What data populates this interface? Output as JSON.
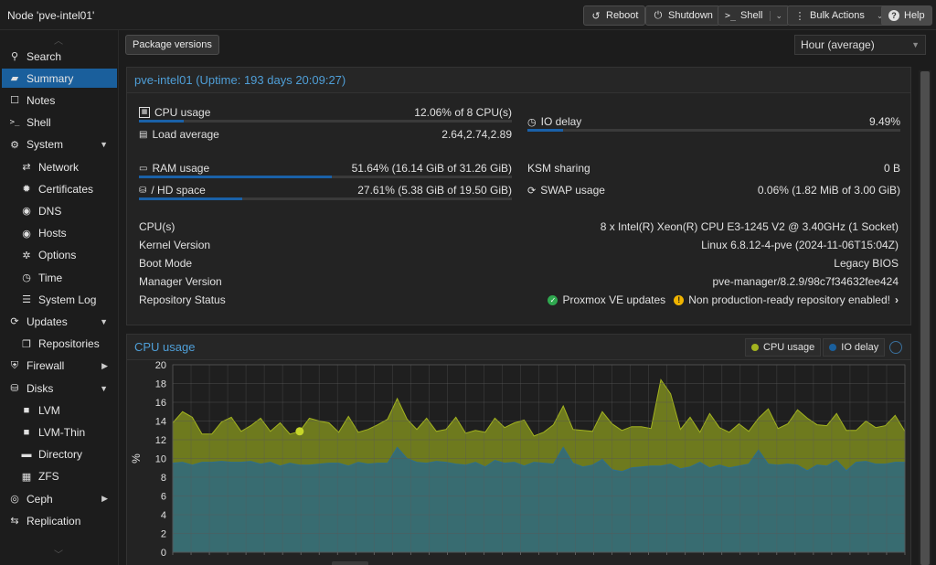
{
  "header": {
    "node_title": "Node 'pve-intel01'",
    "reboot": "Reboot",
    "shutdown": "Shutdown",
    "shell": "Shell",
    "bulk_actions": "Bulk Actions",
    "help": "Help"
  },
  "sidebar": {
    "items": [
      {
        "label": "Search",
        "icon": "search-icon",
        "level": 0
      },
      {
        "label": "Summary",
        "icon": "book-icon",
        "level": 0,
        "selected": true
      },
      {
        "label": "Notes",
        "icon": "notes-icon",
        "level": 0
      },
      {
        "label": "Shell",
        "icon": "terminal-icon",
        "level": 0
      },
      {
        "label": "System",
        "icon": "gears-icon",
        "level": 0,
        "expanded": true
      },
      {
        "label": "Network",
        "icon": "exchange-icon",
        "level": 1
      },
      {
        "label": "Certificates",
        "icon": "certificate-icon",
        "level": 1
      },
      {
        "label": "DNS",
        "icon": "globe-icon",
        "level": 1
      },
      {
        "label": "Hosts",
        "icon": "globe-icon",
        "level": 1
      },
      {
        "label": "Options",
        "icon": "gear-icon",
        "level": 1
      },
      {
        "label": "Time",
        "icon": "clock-icon",
        "level": 1
      },
      {
        "label": "System Log",
        "icon": "list-icon",
        "level": 1
      },
      {
        "label": "Updates",
        "icon": "refresh-icon",
        "level": 0,
        "expanded": true
      },
      {
        "label": "Repositories",
        "icon": "files-icon",
        "level": 1
      },
      {
        "label": "Firewall",
        "icon": "shield-icon",
        "level": 0,
        "collapsed": true
      },
      {
        "label": "Disks",
        "icon": "hdd-icon",
        "level": 0,
        "expanded": true
      },
      {
        "label": "LVM",
        "icon": "square-icon",
        "level": 1
      },
      {
        "label": "LVM-Thin",
        "icon": "square-icon",
        "level": 1
      },
      {
        "label": "Directory",
        "icon": "folder-icon",
        "level": 1
      },
      {
        "label": "ZFS",
        "icon": "grid-icon",
        "level": 1
      },
      {
        "label": "Ceph",
        "icon": "ceph-icon",
        "level": 0,
        "collapsed": true
      },
      {
        "label": "Replication",
        "icon": "retweet-icon",
        "level": 0
      }
    ]
  },
  "toolbar": {
    "package_versions": "Package versions",
    "timeframe": "Hour (average)"
  },
  "status_panel": {
    "title": "pve-intel01 (Uptime: 193 days 20:09:27)",
    "cpu_label": "CPU usage",
    "cpu_value": "12.06% of 8 CPU(s)",
    "cpu_fraction": 0.1206,
    "io_label": "IO delay",
    "io_value": "9.49%",
    "io_fraction": 0.0949,
    "load_label": "Load average",
    "load_value": "2.64,2.74,2.89",
    "ram_label": "RAM usage",
    "ram_value": "51.64% (16.14 GiB of 31.26 GiB)",
    "ram_fraction": 0.5164,
    "ksm_label": "KSM sharing",
    "ksm_value": "0 B",
    "hd_label": "/ HD space",
    "hd_value": "27.61% (5.38 GiB of 19.50 GiB)",
    "hd_fraction": 0.2761,
    "swap_label": "SWAP usage",
    "swap_value": "0.06% (1.82 MiB of 3.00 GiB)",
    "swap_fraction": 0.0006,
    "cpus_label": "CPU(s)",
    "cpus_value": "8 x Intel(R) Xeon(R) CPU E3-1245 V2 @ 3.40GHz (1 Socket)",
    "kernel_label": "Kernel Version",
    "kernel_value": "Linux 6.8.12-4-pve (2024-11-06T15:04Z)",
    "boot_label": "Boot Mode",
    "boot_value": "Legacy BIOS",
    "manager_label": "Manager Version",
    "manager_value": "pve-manager/8.2.9/98c7f34632fee424",
    "repo_label": "Repository Status",
    "repo_ok": "Proxmox VE updates",
    "repo_warn": "Non production-ready repository enabled!"
  },
  "cpu_panel": {
    "title": "CPU usage",
    "legend_cpu": "CPU usage",
    "legend_io": "IO delay"
  },
  "colors": {
    "accent": "#1a5f9c",
    "title_blue": "#4f9fd8",
    "cpu_series": "#a3b31f",
    "io_series": "#2f6f8a"
  },
  "chart_data": {
    "type": "area",
    "ylabel": "%",
    "ylim": [
      0,
      20
    ],
    "yticks": [
      0,
      2,
      4,
      6,
      8,
      10,
      12,
      14,
      16,
      18,
      20
    ],
    "grid": true,
    "legend": "top-right",
    "series": [
      {
        "name": "CPU usage",
        "values": [
          13.8,
          15.0,
          14.4,
          12.6,
          12.6,
          13.9,
          14.4,
          12.9,
          13.5,
          14.3,
          12.9,
          13.8,
          12.6,
          12.9,
          14.3,
          14.0,
          13.8,
          12.8,
          14.5,
          12.8,
          13.1,
          13.6,
          14.2,
          16.4,
          14.2,
          13.1,
          14.3,
          12.9,
          13.1,
          14.4,
          12.7,
          13.0,
          12.8,
          14.3,
          13.3,
          13.8,
          14.1,
          12.4,
          12.8,
          13.6,
          15.6,
          13.1,
          13.0,
          12.9,
          15.0,
          13.7,
          13.0,
          13.4,
          13.4,
          13.2,
          18.4,
          16.9,
          13.1,
          14.4,
          12.8,
          14.8,
          13.3,
          12.8,
          13.7,
          12.9,
          14.3,
          15.3,
          13.2,
          13.7,
          15.2,
          14.3,
          13.6,
          13.5,
          14.8,
          13.0,
          13.0,
          14.0,
          13.3,
          13.5,
          14.6,
          12.9
        ]
      },
      {
        "name": "IO delay",
        "values": [
          9.5,
          9.6,
          9.3,
          9.6,
          9.6,
          9.7,
          9.6,
          9.6,
          9.7,
          9.4,
          9.6,
          9.2,
          9.5,
          9.3,
          9.3,
          9.4,
          9.5,
          9.5,
          9.2,
          9.6,
          9.4,
          9.5,
          9.5,
          11.2,
          10.0,
          9.6,
          9.5,
          9.7,
          9.6,
          9.4,
          9.3,
          9.6,
          9.1,
          9.8,
          9.5,
          9.6,
          9.2,
          9.6,
          9.5,
          9.4,
          11.2,
          9.5,
          9.1,
          9.3,
          9.9,
          8.8,
          8.6,
          9.0,
          9.1,
          9.2,
          9.2,
          9.4,
          8.9,
          9.1,
          9.6,
          9.0,
          9.3,
          9.0,
          9.2,
          9.4,
          10.9,
          9.4,
          9.3,
          9.4,
          9.3,
          8.7,
          9.3,
          9.2,
          9.8,
          8.7,
          9.6,
          9.7,
          9.4,
          9.4,
          9.6,
          9.6
        ]
      }
    ]
  }
}
